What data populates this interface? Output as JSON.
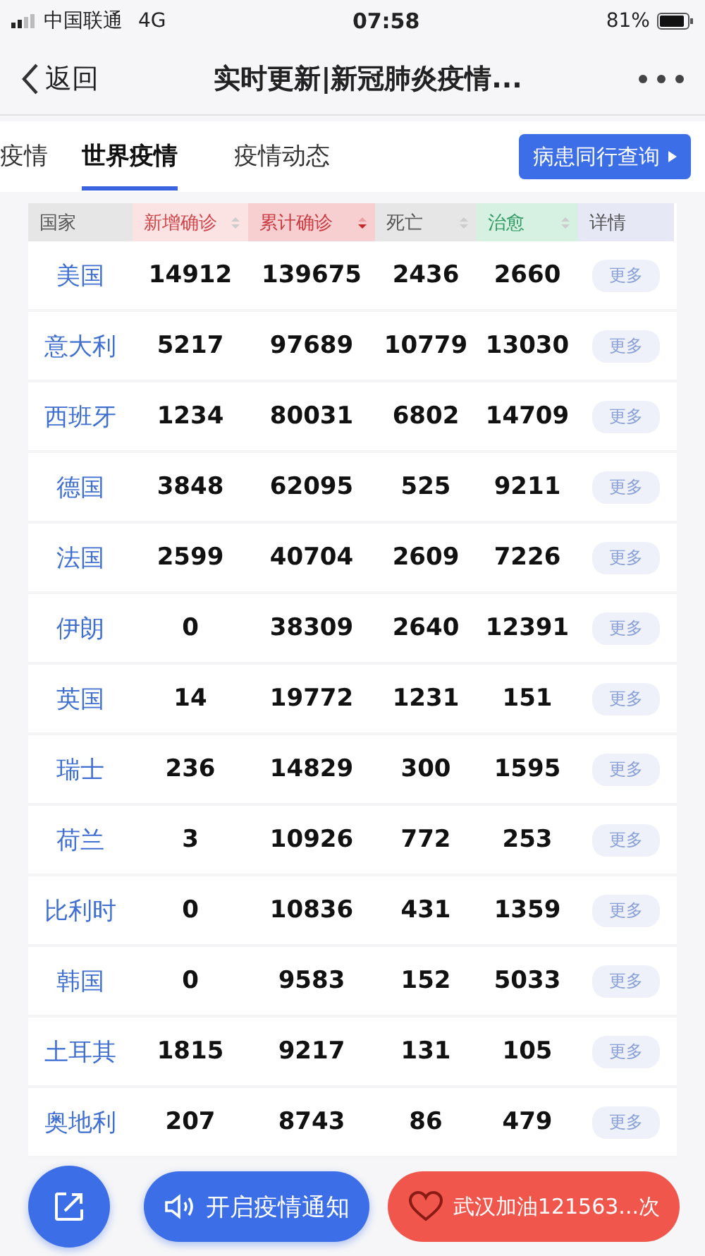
{
  "status_bar": {
    "carrier": "中国联通",
    "network": "4G",
    "time": "07:58",
    "battery": "81%"
  },
  "nav": {
    "back": "返回",
    "title": "实时更新|新冠肺炎疫情..."
  },
  "tabs": [
    {
      "label": "疫情",
      "selected": false
    },
    {
      "label": "世界疫情",
      "selected": true
    },
    {
      "label": "疫情动态",
      "selected": false
    }
  ],
  "query_button": "病患同行查询",
  "table": {
    "columns": [
      {
        "label": "国家",
        "color": "#e6e6e6",
        "sortable": false,
        "sorted": false
      },
      {
        "label": "新增确诊",
        "color": "#fbe3e3",
        "sortable": true,
        "sorted": false
      },
      {
        "label": "累计确诊",
        "color": "#f8cfd1",
        "sortable": true,
        "sorted": true
      },
      {
        "label": "死亡",
        "color": "#e6e6e6",
        "sortable": true,
        "sorted": false
      },
      {
        "label": "治愈",
        "color": "#d6f0e2",
        "sortable": true,
        "sorted": false
      },
      {
        "label": "详情",
        "color": "#e6e8f6",
        "sortable": false,
        "sorted": false
      }
    ],
    "rows": [
      {
        "country": "美国",
        "new": "14912",
        "total": "139675",
        "deaths": "2436",
        "cured": "2660",
        "more": "更多"
      },
      {
        "country": "意大利",
        "new": "5217",
        "total": "97689",
        "deaths": "10779",
        "cured": "13030",
        "more": "更多"
      },
      {
        "country": "西班牙",
        "new": "1234",
        "total": "80031",
        "deaths": "6802",
        "cured": "14709",
        "more": "更多"
      },
      {
        "country": "德国",
        "new": "3848",
        "total": "62095",
        "deaths": "525",
        "cured": "9211",
        "more": "更多"
      },
      {
        "country": "法国",
        "new": "2599",
        "total": "40704",
        "deaths": "2609",
        "cured": "7226",
        "more": "更多"
      },
      {
        "country": "伊朗",
        "new": "0",
        "total": "38309",
        "deaths": "2640",
        "cured": "12391",
        "more": "更多"
      },
      {
        "country": "英国",
        "new": "14",
        "total": "19772",
        "deaths": "1231",
        "cured": "151",
        "more": "更多"
      },
      {
        "country": "瑞士",
        "new": "236",
        "total": "14829",
        "deaths": "300",
        "cured": "1595",
        "more": "更多"
      },
      {
        "country": "荷兰",
        "new": "3",
        "total": "10926",
        "deaths": "772",
        "cured": "253",
        "more": "更多"
      },
      {
        "country": "比利时",
        "new": "0",
        "total": "10836",
        "deaths": "431",
        "cured": "1359",
        "more": "更多"
      },
      {
        "country": "韩国",
        "new": "0",
        "total": "9583",
        "deaths": "152",
        "cured": "5033",
        "more": "更多"
      },
      {
        "country": "土耳其",
        "new": "1815",
        "total": "9217",
        "deaths": "131",
        "cured": "105",
        "more": "更多"
      },
      {
        "country": "奥地利",
        "new": "207",
        "total": "8743",
        "deaths": "86",
        "cured": "479",
        "more": "更多"
      }
    ]
  },
  "bottom": {
    "notify": "开启疫情通知",
    "cheer": "武汉加油121563...次"
  }
}
